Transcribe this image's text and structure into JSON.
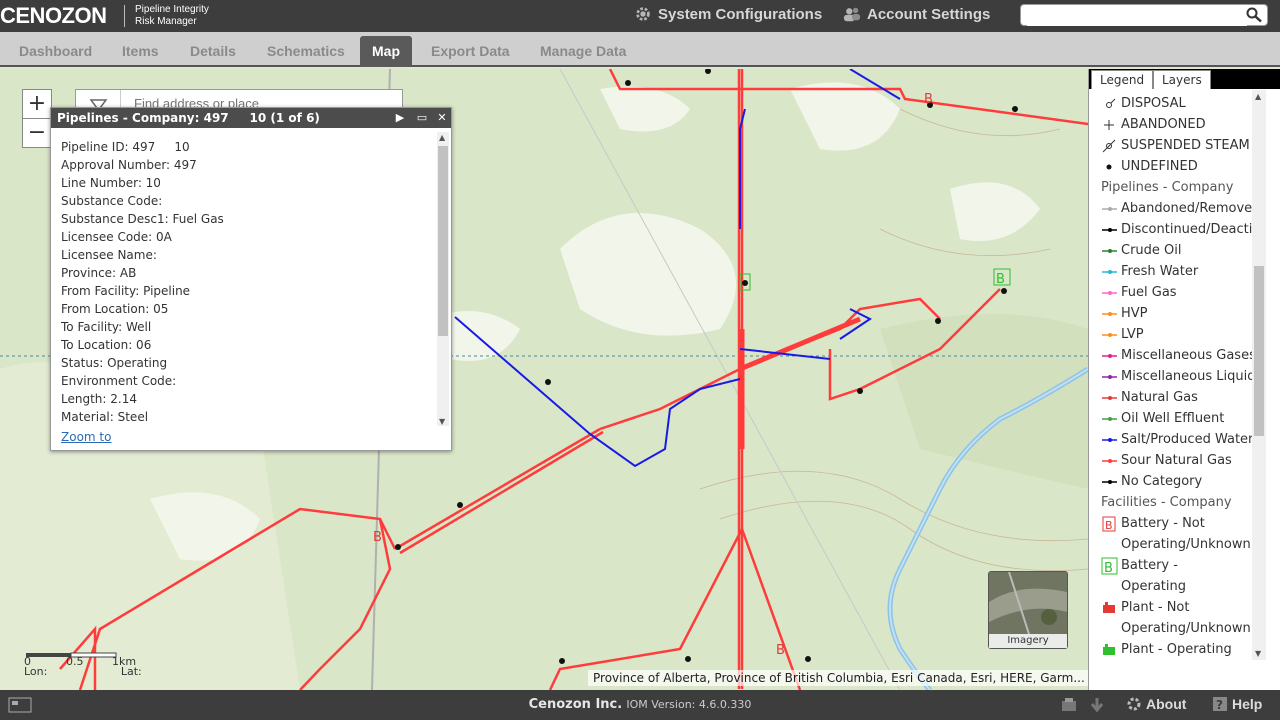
{
  "header": {
    "logo": "CENOZON",
    "logo_sub_1": "Pipeline Integrity",
    "logo_sub_2": "Risk Manager",
    "system_configurations": "System Configurations",
    "account_settings": "Account Settings",
    "search_value": ""
  },
  "nav": {
    "tabs": [
      {
        "label": "Dashboard"
      },
      {
        "label": "Items"
      },
      {
        "label": "Details"
      },
      {
        "label": "Schematics"
      },
      {
        "label": "Map",
        "active": true
      },
      {
        "label": "Export Data"
      },
      {
        "label": "Manage Data"
      }
    ]
  },
  "map": {
    "search_placeholder": "Find address or place",
    "zoom_in": "+",
    "zoom_out": "−",
    "attribution": "Province of Alberta, Province of British Columbia, Esri Canada, Esri, HERE, Garm...",
    "imagery_label": "Imagery",
    "scale": {
      "l0": "0",
      "l1": "0.5",
      "l2": "1km"
    },
    "lon_label": "Lon:",
    "lat_label": "Lat:"
  },
  "popup": {
    "title": "Pipelines - Company: 497     10 (1 of 6)",
    "attributes": [
      "Pipeline ID: 497     10",
      "Approval Number: 497",
      "Line Number: 10",
      "Substance Code:",
      "Substance Desc1: Fuel Gas",
      "Licensee Code: 0A",
      "Licensee Name:",
      "Province: AB",
      "From Facility: Pipeline",
      "From Location: 05",
      "To Facility: Well",
      "To Location: 06",
      "Status: Operating",
      "Environment Code:",
      "Length: 2.14",
      "Material: Steel"
    ],
    "zoom_to": "Zoom to"
  },
  "legend": {
    "tab_legend": "Legend",
    "tab_layers": "Layers",
    "wells": [
      {
        "label": "DISPOSAL",
        "icon": "disposal-icon"
      },
      {
        "label": "ABANDONED",
        "icon": "abandoned-icon"
      },
      {
        "label": "SUSPENDED STEAM W",
        "icon": "suspended-steam-icon"
      },
      {
        "label": "UNDEFINED",
        "icon": "undefined-icon"
      }
    ],
    "pipelines_heading": "Pipelines - Company",
    "pipelines": [
      {
        "label": "Abandoned/Removed",
        "color": "#aaaaaa"
      },
      {
        "label": "Discontinued/Deactiv",
        "color": "#000000"
      },
      {
        "label": "Crude Oil",
        "color": "#2e7d32"
      },
      {
        "label": "Fresh Water",
        "color": "#29b6d6"
      },
      {
        "label": "Fuel Gas",
        "color": "#ff66cc"
      },
      {
        "label": "HVP",
        "color": "#ff8c1a"
      },
      {
        "label": "LVP",
        "color": "#ff8c1a"
      },
      {
        "label": "Miscellaneous Gases",
        "color": "#e0208f"
      },
      {
        "label": "Miscellaneous Liquids",
        "color": "#8e24aa"
      },
      {
        "label": "Natural Gas",
        "color": "#e53935"
      },
      {
        "label": "Oil Well Effluent",
        "color": "#43a047"
      },
      {
        "label": "Salt/Produced Water",
        "color": "#1a1ae6"
      },
      {
        "label": "Sour Natural Gas",
        "color": "#ff3b3b"
      },
      {
        "label": "No Category",
        "color": "#000000"
      }
    ],
    "facilities_heading": "Facilities - Company",
    "facilities": [
      {
        "line1": "Battery - Not",
        "line2": "Operating/Unknown",
        "icon": "battery-not-operating-icon",
        "color": "#e53935"
      },
      {
        "line1": "Battery -",
        "line2": "Operating",
        "icon": "battery-operating-icon",
        "color": "#2fbf2f"
      },
      {
        "line1": "Plant - Not",
        "line2": "Operating/Unknown",
        "icon": "plant-not-operating-icon",
        "color": "#e53935"
      },
      {
        "line1": "Plant - Operating",
        "line2": "",
        "icon": "plant-operating-icon",
        "color": "#2fbf2f"
      }
    ]
  },
  "footer": {
    "company": "Cenozon Inc.",
    "version": "IOM Version: 4.6.0.330",
    "about": "About",
    "help": "Help"
  }
}
